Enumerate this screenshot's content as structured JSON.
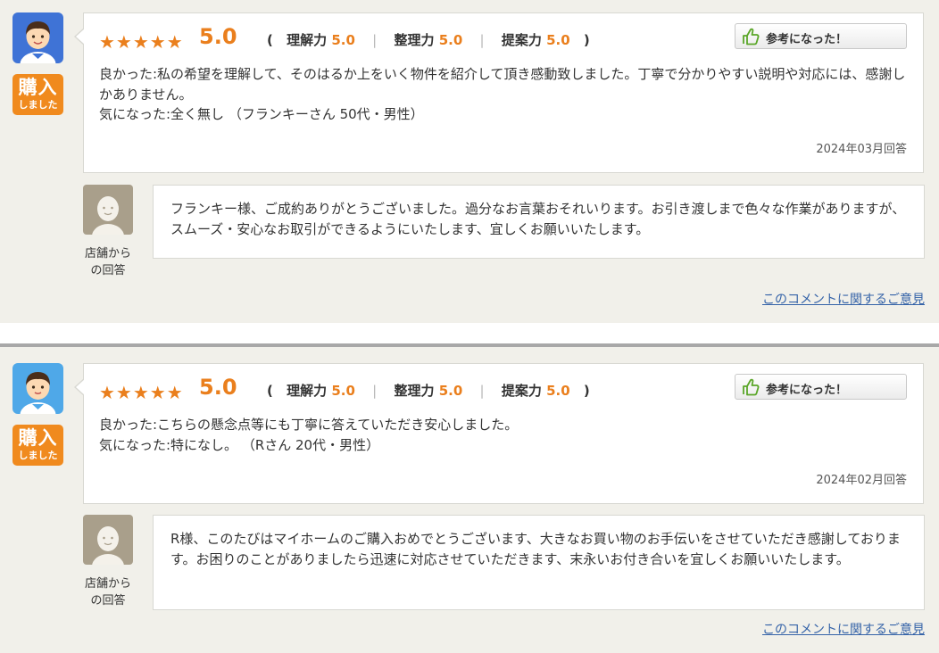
{
  "reviews": [
    {
      "purchase_badge": {
        "main": "購入",
        "sub": "しました"
      },
      "stars": "★★★★★",
      "total_score": "5.0",
      "scores": {
        "understanding_label": "理解力",
        "understanding_value": "5.0",
        "organization_label": "整理力",
        "organization_value": "5.0",
        "proposal_label": "提案力",
        "proposal_value": "5.0"
      },
      "helpful_label": "参考になった！",
      "good_points": "良かった:私の希望を理解して、そのはるか上をいく物件を紹介して頂き感動致しました。丁寧で分かりやすい説明や対応には、感謝しかありません。",
      "concerns": "気になった:全く無し （フランキーさん 50代・男性）",
      "date": "2024年03月回答",
      "shop_label_line1": "店舗から",
      "shop_label_line2": "の回答",
      "reply": "フランキー様、ご成約ありがとうございました。過分なお言葉おそれいります。お引き渡しまで色々な作業がありますが、スムーズ・安心なお取引ができるようにいたします、宜しくお願いいたします。",
      "opinion_link": "このコメントに関するご意見"
    },
    {
      "purchase_badge": {
        "main": "購入",
        "sub": "しました"
      },
      "stars": "★★★★★",
      "total_score": "5.0",
      "scores": {
        "understanding_label": "理解力",
        "understanding_value": "5.0",
        "organization_label": "整理力",
        "organization_value": "5.0",
        "proposal_label": "提案力",
        "proposal_value": "5.0"
      },
      "helpful_label": "参考になった！",
      "good_points": "良かった:こちらの懸念点等にも丁寧に答えていただき安心しました。",
      "concerns": "気になった:特になし。 （Rさん 20代・男性）",
      "date": "2024年02月回答",
      "shop_label_line1": "店舗から",
      "shop_label_line2": "の回答",
      "reply": "R様、このたびはマイホームのご購入おめでとうございます、大きなお買い物のお手伝いをさせていただき感謝しております。お困りのことがありましたら迅速に対応させていただきます、末永いお付き合いを宜しくお願いいたします。",
      "opinion_link": "このコメントに関するご意見"
    }
  ],
  "colors": {
    "accent": "#ea7f1d",
    "badge": "#f08a1e",
    "link": "#3563a8",
    "background": "#f1f0ea"
  },
  "icons": [
    "user-avatar-icon",
    "helpful-hand-icon",
    "shop-staff-avatar-icon"
  ]
}
